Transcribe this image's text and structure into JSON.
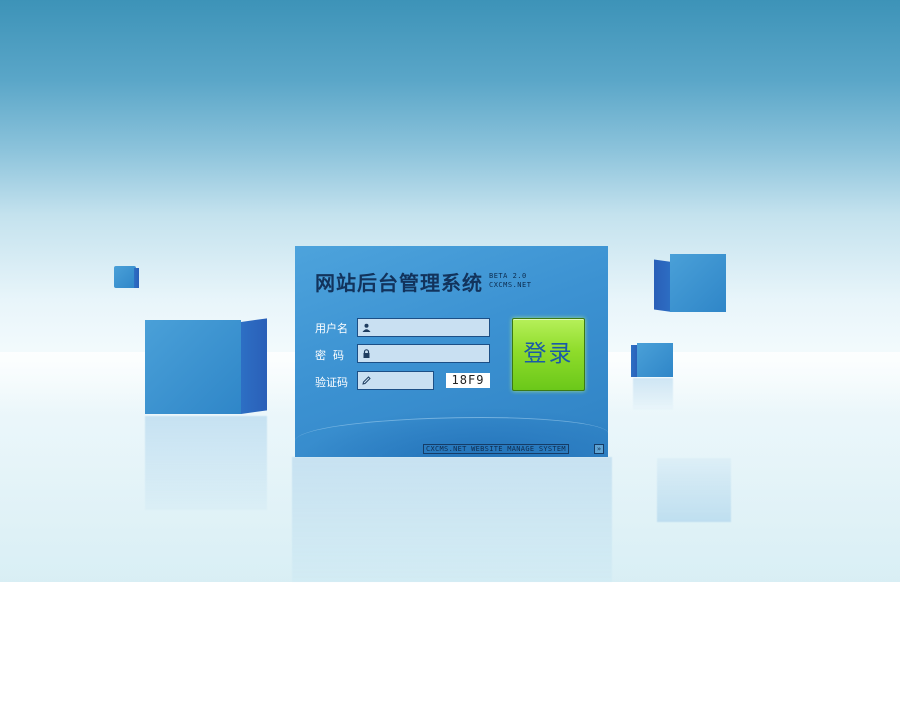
{
  "login": {
    "title": "网站后台管理系统",
    "version": "BETA 2.0",
    "site": "CXCMS.NET",
    "username_label": "用户名",
    "password_label": "密  码",
    "captcha_label": "验证码",
    "username_value": "",
    "password_value": "",
    "captcha_value": "",
    "captcha_text": "18F9",
    "login_button": "登录",
    "footer_text": "CXCMS.NET WEBSITE MANAGE SYSTEM"
  },
  "icons": {
    "username": "user-icon",
    "password": "lock-icon",
    "captcha": "pencil-icon",
    "footer": "arrow-icon"
  },
  "colors": {
    "panel": "#3c92d2",
    "button": "#8fdc2b",
    "button_text": "#1a5aa8",
    "title": "#12335c"
  }
}
